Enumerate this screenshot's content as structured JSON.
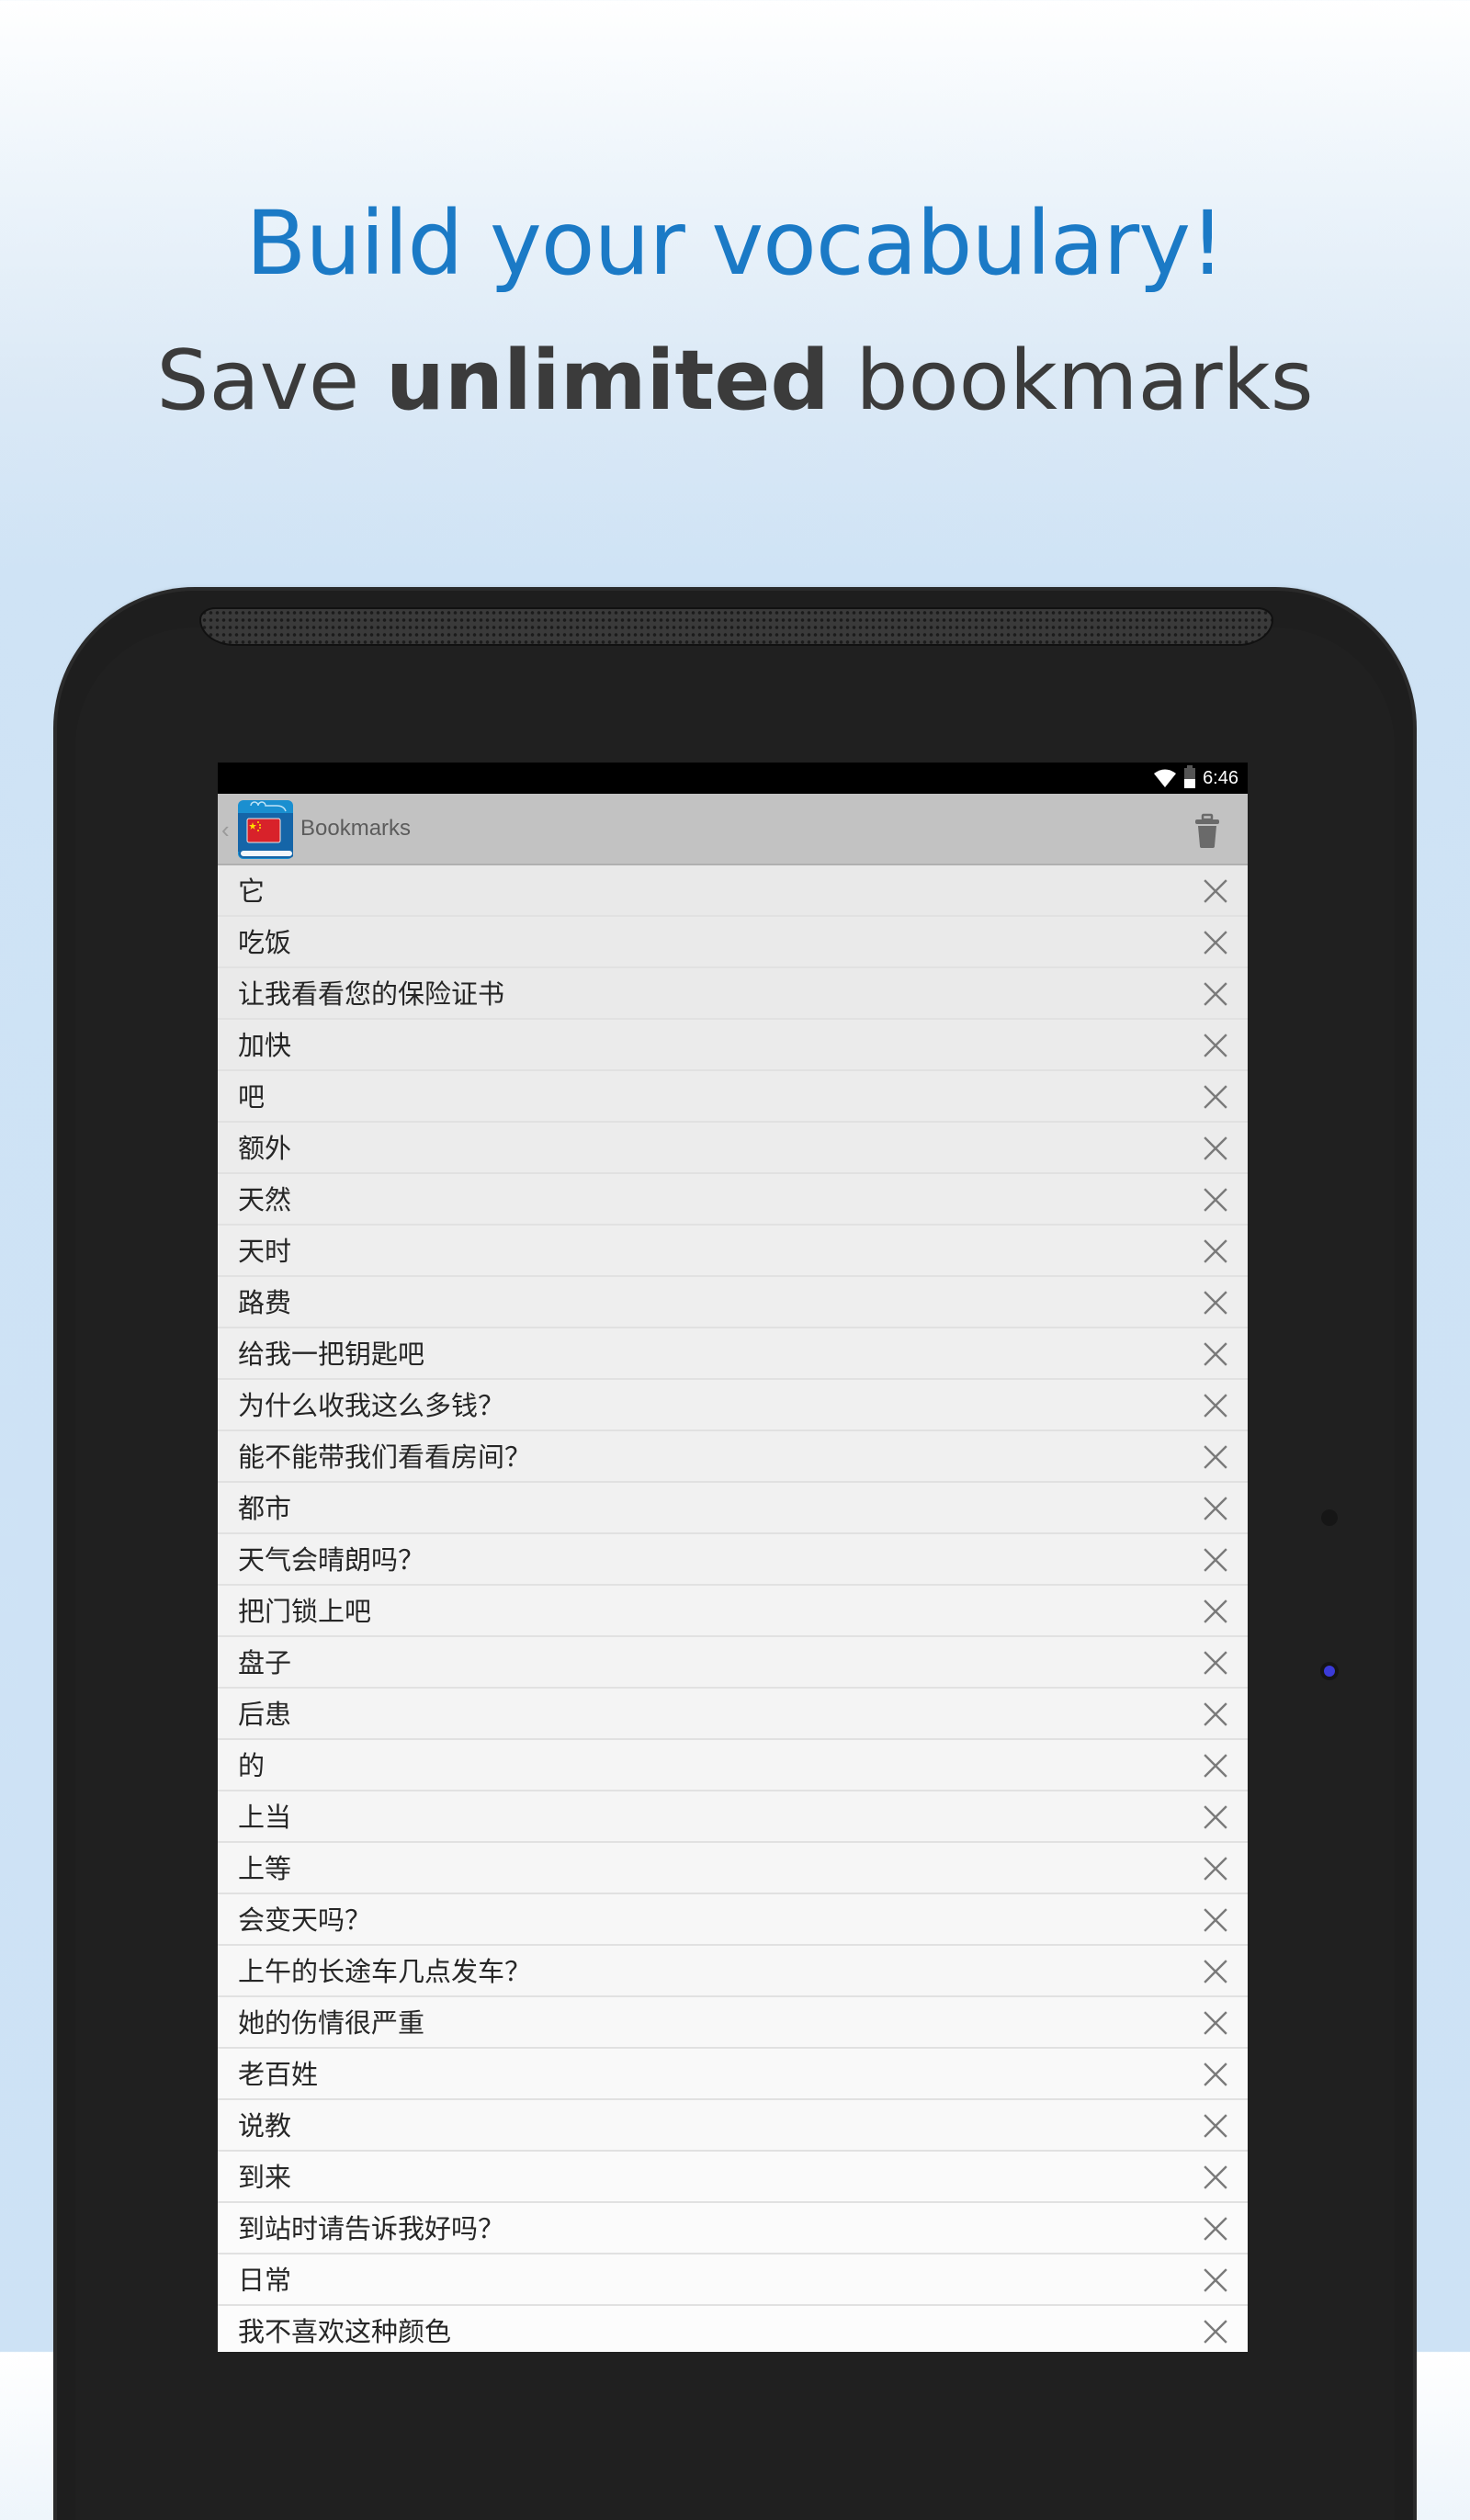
{
  "promo": {
    "headline": "Build your vocabulary!",
    "subline_before": "Save ",
    "subline_bold": "unlimited",
    "subline_after": " bookmarks"
  },
  "colors": {
    "headline": "#1b7ac6",
    "subline": "#3b3b3b",
    "actionbar_bg": "#c2c2c2"
  },
  "status_bar": {
    "icons": [
      "wifi-icon",
      "battery-icon"
    ],
    "time": "6:46"
  },
  "action_bar": {
    "up_glyph": "‹",
    "app_icon": "chinese-dictionary-book-icon",
    "title": "Bookmarks",
    "delete_all_icon": "trash-icon"
  },
  "bookmarks": [
    {
      "text": "它"
    },
    {
      "text": "吃饭"
    },
    {
      "text": "让我看看您的保险证书"
    },
    {
      "text": "加快"
    },
    {
      "text": "吧"
    },
    {
      "text": "额外"
    },
    {
      "text": "天然"
    },
    {
      "text": "天时"
    },
    {
      "text": "路费"
    },
    {
      "text": "给我一把钥匙吧"
    },
    {
      "text": "为什么收我这么多钱？"
    },
    {
      "text": "能不能带我们看看房间？"
    },
    {
      "text": "都市"
    },
    {
      "text": "天气会晴朗吗？"
    },
    {
      "text": "把门锁上吧"
    },
    {
      "text": "盘子"
    },
    {
      "text": "后患"
    },
    {
      "text": "的"
    },
    {
      "text": "上当"
    },
    {
      "text": "上等"
    },
    {
      "text": "会变天吗？"
    },
    {
      "text": "上午的长途车几点发车？"
    },
    {
      "text": "她的伤情很严重"
    },
    {
      "text": "老百姓"
    },
    {
      "text": "说教"
    },
    {
      "text": "到来"
    },
    {
      "text": "到站时请告诉我好吗？"
    },
    {
      "text": "日常"
    },
    {
      "text": "我不喜欢这种颜色"
    }
  ],
  "row_remove_icon": "close-x-icon"
}
